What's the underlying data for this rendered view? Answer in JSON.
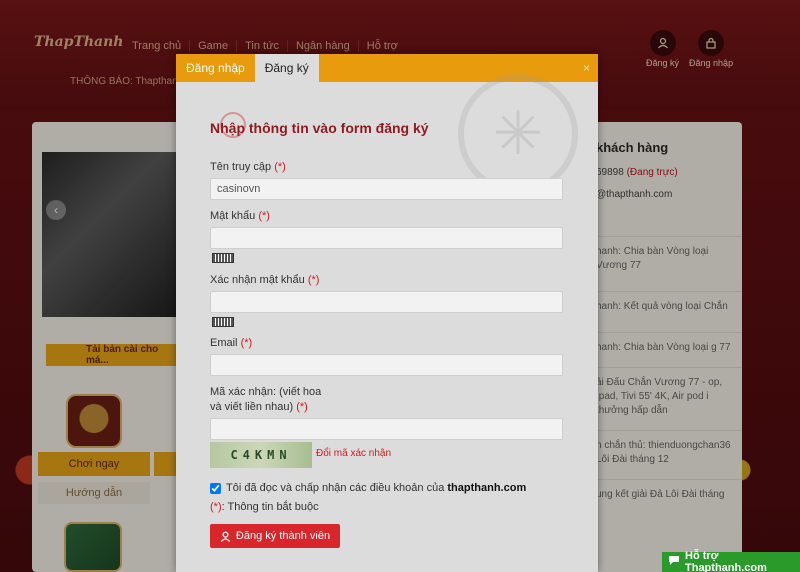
{
  "site": {
    "logo": "ThapThanh",
    "nav": [
      "Trang chủ",
      "Game",
      "Tin tức",
      "Ngân hàng",
      "Hỗ trợ"
    ],
    "notice": "THÔNG BÁO: Thapthanh...",
    "user_actions": [
      {
        "label": "Đăng ký",
        "icon": "user-icon"
      },
      {
        "label": "Đăng nhập",
        "icon": "lock-icon"
      }
    ]
  },
  "left": {
    "download_label": "Tải bản cài cho má...",
    "play_label": "Chơi ngay",
    "guide_label": "Hướng dẫn"
  },
  "right": {
    "title": "khách hàng",
    "phone": "69898",
    "phone_status": "(Đang trực)",
    "email": "@thapthanh.com",
    "news": [
      "hanh: Chia bàn Vòng loại Vương 77",
      "hanh: Kết quả vòng loại Chắn",
      "hanh: Chia bàn Vòng loại g 77",
      "ải Đấu Chắn Vương 77 - op, Ipad, Tivi 55' 4K, Air pod i thưởng hấp dẫn",
      "n chắn thủ: thienduongchan36 Lôi Đài tháng 12",
      "ung kết giải Đả Lôi Đài tháng"
    ]
  },
  "modal": {
    "tabs": [
      {
        "label": "Đăng nhập",
        "active": false
      },
      {
        "label": "Đăng ký",
        "active": true
      }
    ],
    "close_label": "×",
    "title": "Nhập thông tin vào form đăng ký",
    "required_mark": "(*)",
    "fields": {
      "username": {
        "label": "Tên truy cập",
        "value": "casinovn"
      },
      "password": {
        "label": "Mật khẩu",
        "value": ""
      },
      "confirm_password": {
        "label": "Xác nhận mật khẩu",
        "value": ""
      },
      "email": {
        "label": "Email",
        "value": ""
      },
      "captcha": {
        "label_line1": "Mã xác nhận: (viết hoa",
        "label_line2": "và viết liền nhau)",
        "value": ""
      }
    },
    "captcha_text": "C4KMN",
    "captcha_refresh": "Đổi mã xác nhận",
    "agree_text": "Tôi đã đọc và chấp nhận các điều khoản của",
    "agree_site": "thapthanh.com",
    "agree_checked": true,
    "required_note": ": Thông tin bắt buộc",
    "submit_label": "Đăng ký thành viên"
  },
  "support": {
    "label": "Hỗ trợ Thapthanh.com",
    "icon": "chat-icon"
  },
  "colors": {
    "accent": "#e89b0c",
    "title_red": "#8e1b1f",
    "button_red": "#d9262b",
    "support_green": "#2a9a2a"
  }
}
